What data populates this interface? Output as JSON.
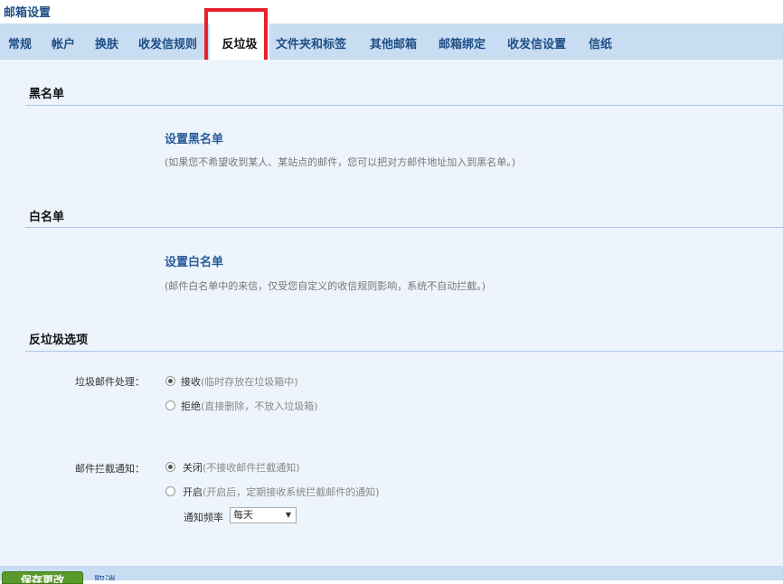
{
  "page_title": "邮箱设置",
  "tabs": [
    {
      "label": "常规"
    },
    {
      "label": "帐户"
    },
    {
      "label": "换肤"
    },
    {
      "label": "收发信规则"
    },
    {
      "label": "反垃圾",
      "active": true
    },
    {
      "label": "文件夹和标签"
    },
    {
      "label": "其他邮箱"
    },
    {
      "label": "邮箱绑定"
    },
    {
      "label": "收发信设置"
    },
    {
      "label": "信纸"
    }
  ],
  "blacklist": {
    "heading": "黑名单",
    "link": "设置黑名单",
    "hint": "(如果您不希望收到某人、某站点的邮件，您可以把对方邮件地址加入到黑名单。)"
  },
  "whitelist": {
    "heading": "白名单",
    "link": "设置白名单",
    "hint": "(邮件白名单中的来信，仅受您自定义的收信规则影响，系统不自动拦截。)"
  },
  "antispam": {
    "heading": "反垃圾选项",
    "junk_label": "垃圾邮件处理：",
    "junk_options": [
      {
        "label": "接收",
        "note": "(临时存放在垃圾箱中)",
        "checked": true
      },
      {
        "label": "拒绝",
        "note": "(直接删除，不放入垃圾箱)",
        "checked": false
      }
    ],
    "notify_label": "邮件拦截通知：",
    "notify_options": [
      {
        "label": "关闭",
        "note": "(不接收邮件拦截通知)",
        "checked": true
      },
      {
        "label": "开启",
        "note": "(开启后，定期接收系统拦截邮件的通知)",
        "checked": false
      }
    ],
    "frequency_label": "通知频率",
    "frequency_value": "每天"
  },
  "footer": {
    "save": "保存更改",
    "cancel": "取消"
  }
}
